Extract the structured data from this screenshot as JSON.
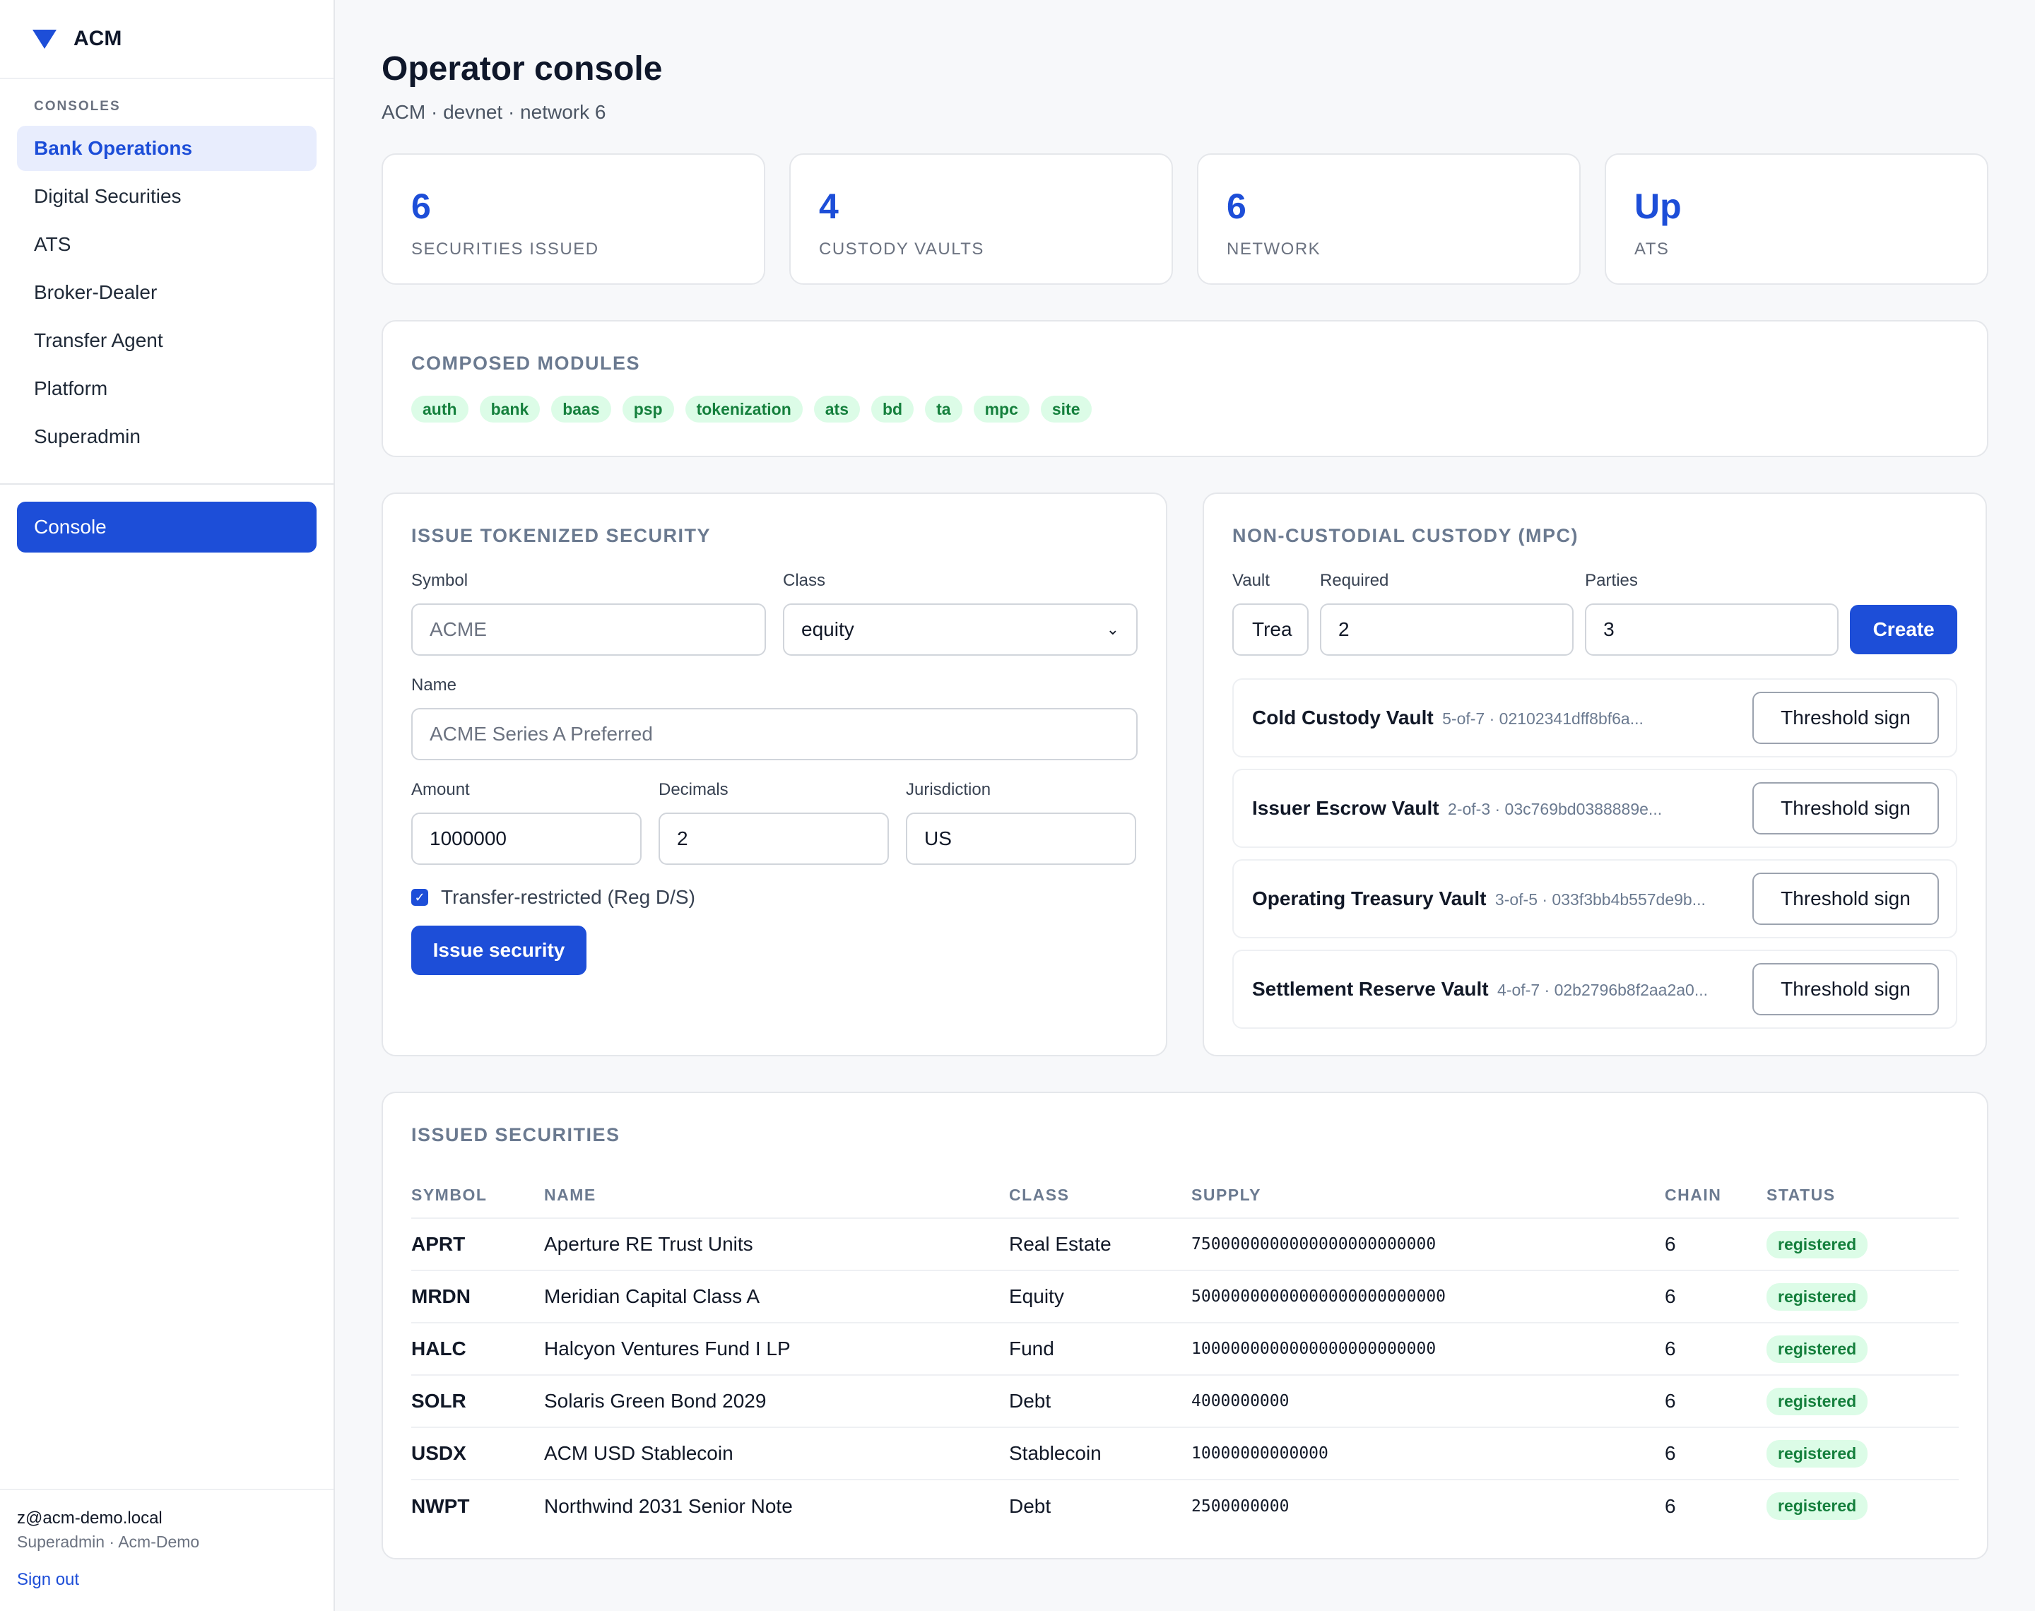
{
  "brand": {
    "name": "ACM"
  },
  "sidebar": {
    "section_title": "CONSOLES",
    "items": [
      {
        "label": "Bank Operations",
        "active": true
      },
      {
        "label": "Digital Securities",
        "active": false
      },
      {
        "label": "ATS",
        "active": false
      },
      {
        "label": "Broker-Dealer",
        "active": false
      },
      {
        "label": "Transfer Agent",
        "active": false
      },
      {
        "label": "Platform",
        "active": false
      },
      {
        "label": "Superadmin",
        "active": false
      }
    ],
    "console_label": "Console",
    "user": {
      "email": "z@acm-demo.local",
      "role": "Superadmin · Acm-Demo",
      "sign_out": "Sign out"
    }
  },
  "header": {
    "title": "Operator console",
    "subtitle": "ACM · devnet · network 6"
  },
  "stats": [
    {
      "value": "6",
      "label": "SECURITIES ISSUED"
    },
    {
      "value": "4",
      "label": "CUSTODY VAULTS"
    },
    {
      "value": "6",
      "label": "NETWORK"
    },
    {
      "value": "Up",
      "label": "ATS"
    }
  ],
  "modules": {
    "title": "COMPOSED MODULES",
    "chips": [
      "auth",
      "bank",
      "baas",
      "psp",
      "tokenization",
      "ats",
      "bd",
      "ta",
      "mpc",
      "site"
    ]
  },
  "issue_form": {
    "title": "ISSUE TOKENIZED SECURITY",
    "symbol": {
      "label": "Symbol",
      "placeholder": "ACME"
    },
    "class": {
      "label": "Class",
      "value": "equity"
    },
    "name": {
      "label": "Name",
      "placeholder": "ACME Series A Preferred"
    },
    "amount": {
      "label": "Amount",
      "value": "1000000"
    },
    "decimals": {
      "label": "Decimals",
      "value": "2"
    },
    "jurisdiction": {
      "label": "Jurisdiction",
      "value": "US"
    },
    "restricted": {
      "label": "Transfer-restricted (Reg D/S)",
      "checked": true
    },
    "submit": "Issue security"
  },
  "mpc": {
    "title": "NON-CUSTODIAL CUSTODY (MPC)",
    "vault": {
      "label": "Vault",
      "value": "Trea"
    },
    "required": {
      "label": "Required",
      "value": "2"
    },
    "parties": {
      "label": "Parties",
      "value": "3"
    },
    "create": "Create",
    "sign_label": "Threshold sign",
    "vaults": [
      {
        "name": "Cold Custody Vault",
        "meta": "5-of-7 · 02102341dff8bf6a..."
      },
      {
        "name": "Issuer Escrow Vault",
        "meta": "2-of-3 · 03c769bd0388889e..."
      },
      {
        "name": "Operating Treasury Vault",
        "meta": "3-of-5 · 033f3bb4b557de9b..."
      },
      {
        "name": "Settlement Reserve Vault",
        "meta": "4-of-7 · 02b2796b8f2aa2a0..."
      }
    ]
  },
  "securities": {
    "title": "ISSUED SECURITIES",
    "columns": [
      "SYMBOL",
      "NAME",
      "CLASS",
      "SUPPLY",
      "CHAIN",
      "STATUS"
    ],
    "rows": [
      {
        "symbol": "APRT",
        "name": "Aperture RE Trust Units",
        "class": "Real Estate",
        "supply": "7500000000000000000000000",
        "chain": "6",
        "status": "registered"
      },
      {
        "symbol": "MRDN",
        "name": "Meridian Capital Class A",
        "class": "Equity",
        "supply": "50000000000000000000000000",
        "chain": "6",
        "status": "registered"
      },
      {
        "symbol": "HALC",
        "name": "Halcyon Ventures Fund I LP",
        "class": "Fund",
        "supply": "1000000000000000000000000",
        "chain": "6",
        "status": "registered"
      },
      {
        "symbol": "SOLR",
        "name": "Solaris Green Bond 2029",
        "class": "Debt",
        "supply": "4000000000",
        "chain": "6",
        "status": "registered"
      },
      {
        "symbol": "USDX",
        "name": "ACM USD Stablecoin",
        "class": "Stablecoin",
        "supply": "10000000000000",
        "chain": "6",
        "status": "registered"
      },
      {
        "symbol": "NWPT",
        "name": "Northwind 2031 Senior Note",
        "class": "Debt",
        "supply": "2500000000",
        "chain": "6",
        "status": "registered"
      }
    ]
  },
  "colors": {
    "accent": "#1d4ed8",
    "success_bg": "#dcfce7",
    "success_fg": "#15803d"
  }
}
